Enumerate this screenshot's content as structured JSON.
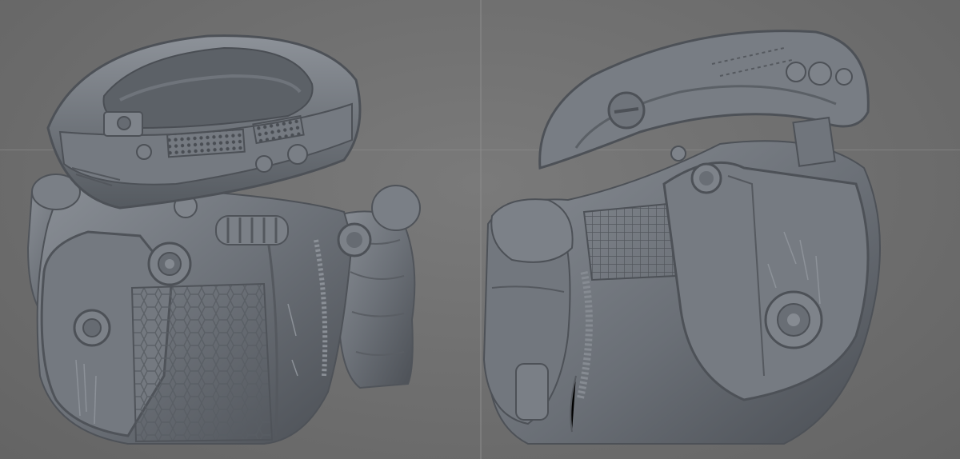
{
  "viewport": {
    "background": "#6f6f6f",
    "model_color": "#6b7179",
    "views": [
      "front-three-quarter-view",
      "rear-three-quarter-view"
    ]
  }
}
